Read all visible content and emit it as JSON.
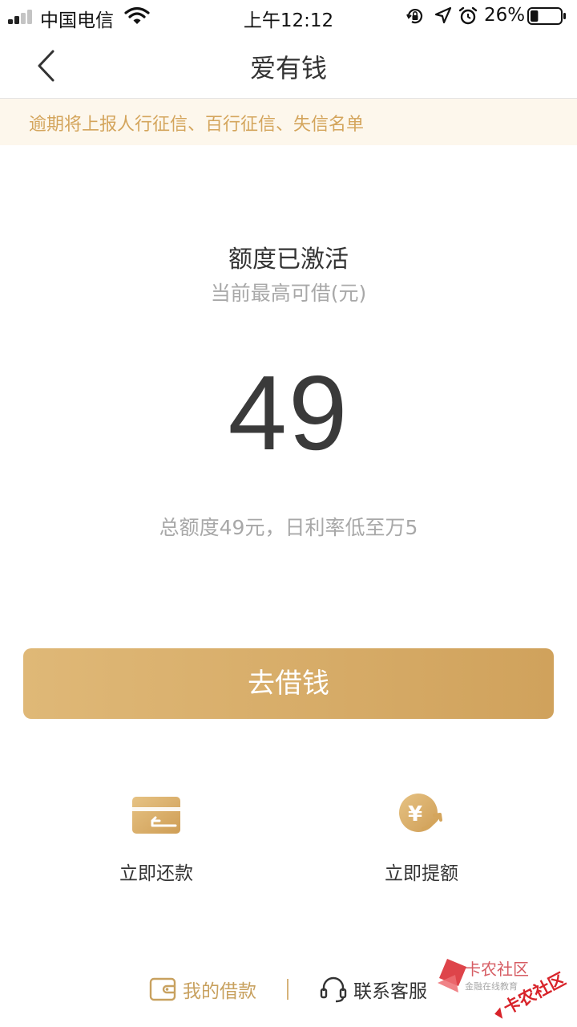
{
  "status_bar": {
    "carrier": "中国电信",
    "time": "上午12:12",
    "battery_percent": "26%",
    "battery_level": 0.26
  },
  "nav": {
    "title": "爱有钱"
  },
  "banner": {
    "text": "逾期将上报人行征信、百行征信、失信名单"
  },
  "quota": {
    "status": "额度已激活",
    "subtitle": "当前最高可借(元)",
    "amount": "49",
    "description": "总额度49元，日利率低至万5"
  },
  "actions": {
    "borrow_label": "去借钱",
    "repay_label": "立即还款",
    "raise_label": "立即提额",
    "raise_icon_glyph": "¥"
  },
  "bottom": {
    "my_loans": "我的借款",
    "customer_service": "联系客服"
  },
  "watermark": {
    "brand": "卡农社区",
    "tagline": "金融在线教育",
    "stamp": "卡农社区"
  },
  "colors": {
    "accent_gold": "#d4a55c",
    "banner_bg": "#fdf7ec",
    "button_start": "#dfb877",
    "button_end": "#d0a25c",
    "watermark_red": "#d8232a"
  }
}
